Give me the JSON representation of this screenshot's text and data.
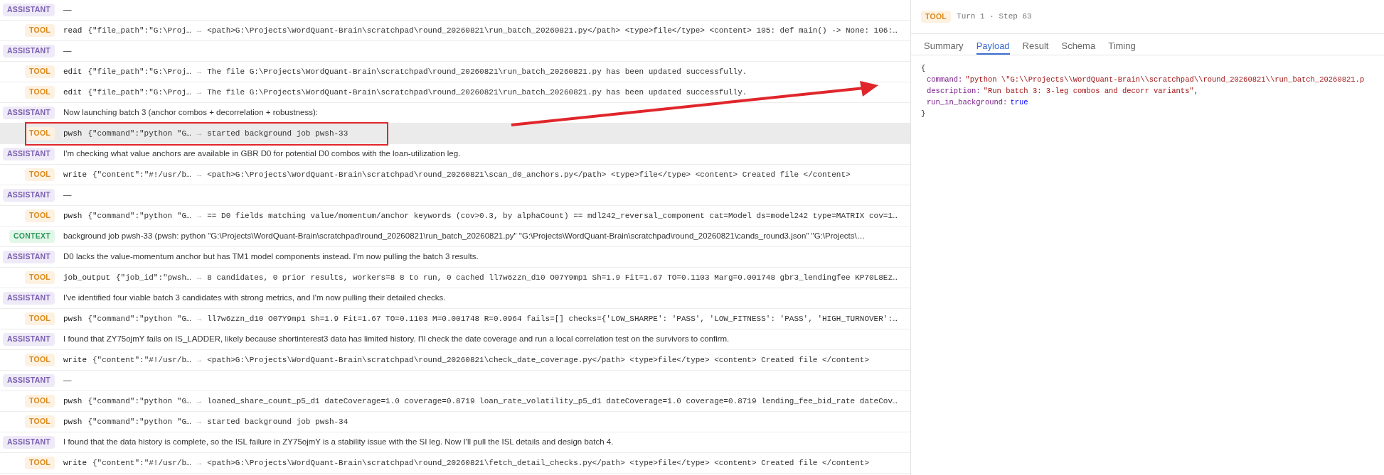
{
  "rows": [
    {
      "kind": "assistant",
      "role": "ASSISTANT",
      "text": "—",
      "selected": false
    },
    {
      "kind": "tool",
      "role": "TOOL",
      "name": "read",
      "args": "{\"file_path\":\"G:\\Proj…",
      "arrow": "→",
      "result": "<path>G:\\Projects\\WordQuant-Brain\\scratchpad\\round_20260821\\run_batch_20260821.py</path> <type>file</type> <content> 105: def main() -> None: 106:…",
      "selected": false
    },
    {
      "kind": "assistant",
      "role": "ASSISTANT",
      "text": "—",
      "selected": false
    },
    {
      "kind": "tool",
      "role": "TOOL",
      "name": "edit",
      "args": "{\"file_path\":\"G:\\Proj…",
      "arrow": "→",
      "result": "The file G:\\Projects\\WordQuant-Brain\\scratchpad\\round_20260821\\run_batch_20260821.py has been updated successfully.",
      "selected": false
    },
    {
      "kind": "tool",
      "role": "TOOL",
      "name": "edit",
      "args": "{\"file_path\":\"G:\\Proj…",
      "arrow": "→",
      "result": "The file G:\\Projects\\WordQuant-Brain\\scratchpad\\round_20260821\\run_batch_20260821.py has been updated successfully.",
      "selected": false
    },
    {
      "kind": "assistant",
      "role": "ASSISTANT",
      "text": "Now launching batch 3 (anchor combos + decorrelation + robustness):",
      "selected": false
    },
    {
      "kind": "tool",
      "role": "TOOL",
      "name": "pwsh",
      "args": "{\"command\":\"python \"G…",
      "arrow": "→",
      "result": "started background job pwsh-33",
      "selected": true
    },
    {
      "kind": "assistant",
      "role": "ASSISTANT",
      "text": "I'm checking what value anchors are available in GBR D0 for potential D0 combos with the loan-utilization leg.",
      "selected": false
    },
    {
      "kind": "tool",
      "role": "TOOL",
      "name": "write",
      "args": "{\"content\":\"#!/usr/b…",
      "arrow": "→",
      "result": "<path>G:\\Projects\\WordQuant-Brain\\scratchpad\\round_20260821\\scan_d0_anchors.py</path> <type>file</type> <content> Created file </content>",
      "selected": false
    },
    {
      "kind": "assistant",
      "role": "ASSISTANT",
      "text": "—",
      "selected": false
    },
    {
      "kind": "tool",
      "role": "TOOL",
      "name": "pwsh",
      "args": "{\"command\":\"python \"G…",
      "arrow": "→",
      "result": "== D0 fields matching value/momentum/anchor keywords (cov>0.3, by alphaCount) == mdl242_reversal_component cat=Model ds=model242 type=MATRIX cov=1…",
      "selected": false
    },
    {
      "kind": "context",
      "role": "CONTEXT",
      "text": "background job pwsh-33 (pwsh: python \"G:\\Projects\\WordQuant-Brain\\scratchpad\\round_20260821\\run_batch_20260821.py\" \"G:\\Projects\\WordQuant-Brain\\scratchpad\\round_20260821\\cands_round3.json\" \"G:\\Projects\\…",
      "selected": false
    },
    {
      "kind": "assistant",
      "role": "ASSISTANT",
      "text": "D0 lacks the value-momentum anchor but has TM1 model components instead. I'm now pulling the batch 3 results.",
      "selected": false
    },
    {
      "kind": "tool",
      "role": "TOOL",
      "name": "job_output",
      "args": "{\"job_id\":\"pwsh…",
      "arrow": "→",
      "result": "8 candidates, 0 prior results, workers=8 8 to run, 0 cached ll7w6zzn_d10 O07Y9mp1 Sh=1.9 Fit=1.67 TO=0.1103 Marg=0.001748 gbr3_lendingfee KP70L8Ez…",
      "selected": false
    },
    {
      "kind": "assistant",
      "role": "ASSISTANT",
      "text": "I've identified four viable batch 3 candidates with strong metrics, and I'm now pulling their detailed checks.",
      "selected": false
    },
    {
      "kind": "tool",
      "role": "TOOL",
      "name": "pwsh",
      "args": "{\"command\":\"python \"G…",
      "arrow": "→",
      "result": "ll7w6zzn_d10 O07Y9mp1 Sh=1.9 Fit=1.67 TO=0.1103 M=0.001748 R=0.0964 fails=[] checks={'LOW_SHARPE': 'PASS', 'LOW_FITNESS': 'PASS', 'HIGH_TURNOVER':…",
      "selected": false
    },
    {
      "kind": "assistant",
      "role": "ASSISTANT",
      "text": "I found that ZY75ojmY fails on IS_LADDER, likely because shortinterest3 data has limited history. I'll check the date coverage and run a local correlation test on the survivors to confirm.",
      "selected": false
    },
    {
      "kind": "tool",
      "role": "TOOL",
      "name": "write",
      "args": "{\"content\":\"#!/usr/b…",
      "arrow": "→",
      "result": "<path>G:\\Projects\\WordQuant-Brain\\scratchpad\\round_20260821\\check_date_coverage.py</path> <type>file</type> <content> Created file </content>",
      "selected": false
    },
    {
      "kind": "assistant",
      "role": "ASSISTANT",
      "text": "—",
      "selected": false
    },
    {
      "kind": "tool",
      "role": "TOOL",
      "name": "pwsh",
      "args": "{\"command\":\"python \"G…",
      "arrow": "→",
      "result": "loaned_share_count_p5_d1 dateCoverage=1.0 coverage=0.8719 loan_rate_volatility_p5_d1 dateCoverage=1.0 coverage=0.8719 lending_fee_bid_rate dateCov…",
      "selected": false
    },
    {
      "kind": "tool",
      "role": "TOOL",
      "name": "pwsh",
      "args": "{\"command\":\"python \"G…",
      "arrow": "→",
      "result": "started background job pwsh-34",
      "selected": false
    },
    {
      "kind": "assistant",
      "role": "ASSISTANT",
      "text": "I found that the data history is complete, so the ISL failure in ZY75ojmY is a stability issue with the SI leg. Now I'll pull the ISL details and design batch 4.",
      "selected": false
    },
    {
      "kind": "tool",
      "role": "TOOL",
      "name": "write",
      "args": "{\"content\":\"#!/usr/b…",
      "arrow": "→",
      "result": "<path>G:\\Projects\\WordQuant-Brain\\scratchpad\\round_20260821\\fetch_detail_checks.py</path> <type>file</type> <content> Created file </content>",
      "selected": false
    }
  ],
  "detail": {
    "badge": "TOOL",
    "kind": "tool",
    "subtitle": "Turn 1 · Step 63",
    "tabs": [
      {
        "label": "Summary",
        "selected": false
      },
      {
        "label": "Payload",
        "selected": true
      },
      {
        "label": "Result",
        "selected": false
      },
      {
        "label": "Schema",
        "selected": false
      },
      {
        "label": "Timing",
        "selected": false
      }
    ],
    "open": "{",
    "close": "}",
    "fields": [
      {
        "key": "command:",
        "value": "\"python \\\"G:\\\\Projects\\\\WordQuant-Brain\\\\scratchpad\\\\round_20260821\\\\run_batch_20260821.p",
        "kind": "string"
      },
      {
        "key": "description:",
        "value": "\"Run batch 3: 3-leg combos and decorr variants\"",
        "kind": "string",
        "suffix": ","
      },
      {
        "key": "run_in_background:",
        "value": "true",
        "kind": "bool"
      }
    ]
  }
}
